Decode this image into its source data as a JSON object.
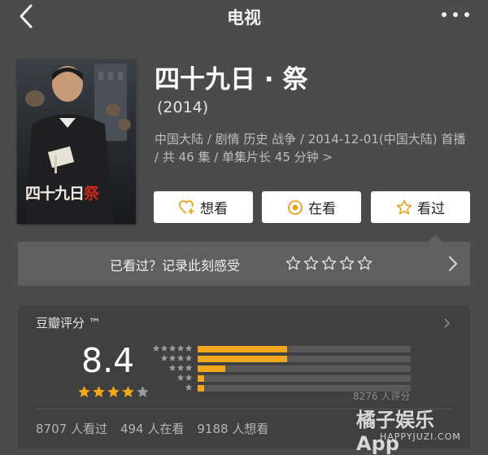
{
  "nav": {
    "title": "电视"
  },
  "show": {
    "title": "四十九日 · 祭",
    "year": "(2014)",
    "meta": "中国大陆 / 剧情 历史 战争 / 2014-12-01(中国大陆) 首播 / 共 46 集 / 单集片长 45 分钟",
    "meta_chevron": ">",
    "poster_title": "四十九日",
    "poster_title_accent": "祭"
  },
  "actions": [
    {
      "label": "想看",
      "icon": "heart-plus-icon"
    },
    {
      "label": "在看",
      "icon": "target-icon"
    },
    {
      "label": "看过",
      "icon": "star-outline-icon"
    }
  ],
  "rate_prompt": {
    "text": "已看过？记录此刻感受",
    "stars": 5
  },
  "douban": {
    "label": "豆瓣评分 ™",
    "score": "8.4",
    "stars_filled": 4,
    "stars_total": 5,
    "distribution": [
      {
        "stars": 5,
        "fraction": 0.42
      },
      {
        "stars": 4,
        "fraction": 0.42
      },
      {
        "stars": 3,
        "fraction": 0.13
      },
      {
        "stars": 2,
        "fraction": 0.03
      },
      {
        "stars": 1,
        "fraction": 0.03
      }
    ],
    "rating_count": "8276 人评分",
    "stats": [
      "8707 人看过",
      "494 人在看",
      "9188 人想看"
    ]
  },
  "watermark": {
    "brand": "橘子娱乐App",
    "url": "HAPPYJUZI.COM"
  },
  "colors": {
    "accent": "#f0a71e",
    "background": "#4b4b4b",
    "card": "#404040",
    "rate_bar": "#5f5f5f"
  }
}
